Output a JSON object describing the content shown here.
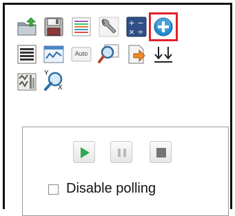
{
  "toolbar": {
    "auto_label": "Auto",
    "items": [
      {
        "icon": "upload-icon"
      },
      {
        "icon": "save-icon"
      },
      {
        "icon": "line-styles-icon"
      },
      {
        "icon": "wrench-icon"
      },
      {
        "icon": "calculator-icon"
      },
      {
        "icon": "add-icon",
        "highlighted": true
      },
      {
        "icon": "list-icon"
      },
      {
        "icon": "chart-window-icon"
      },
      {
        "icon": "auto-scale-icon"
      },
      {
        "icon": "zoom-icon"
      },
      {
        "icon": "export-icon"
      },
      {
        "icon": "align-bottom-icon"
      },
      {
        "icon": "multi-chart-icon"
      },
      {
        "icon": "xy-zoom-icon"
      }
    ],
    "xy_zoom": {
      "y_label": "Y",
      "x_label": "X"
    }
  },
  "polling": {
    "disable_label": "Disable polling",
    "disable_checked": false
  },
  "colors": {
    "highlight": "#e0202a",
    "play": "#2fa84f",
    "add": "#1f8bd6"
  }
}
